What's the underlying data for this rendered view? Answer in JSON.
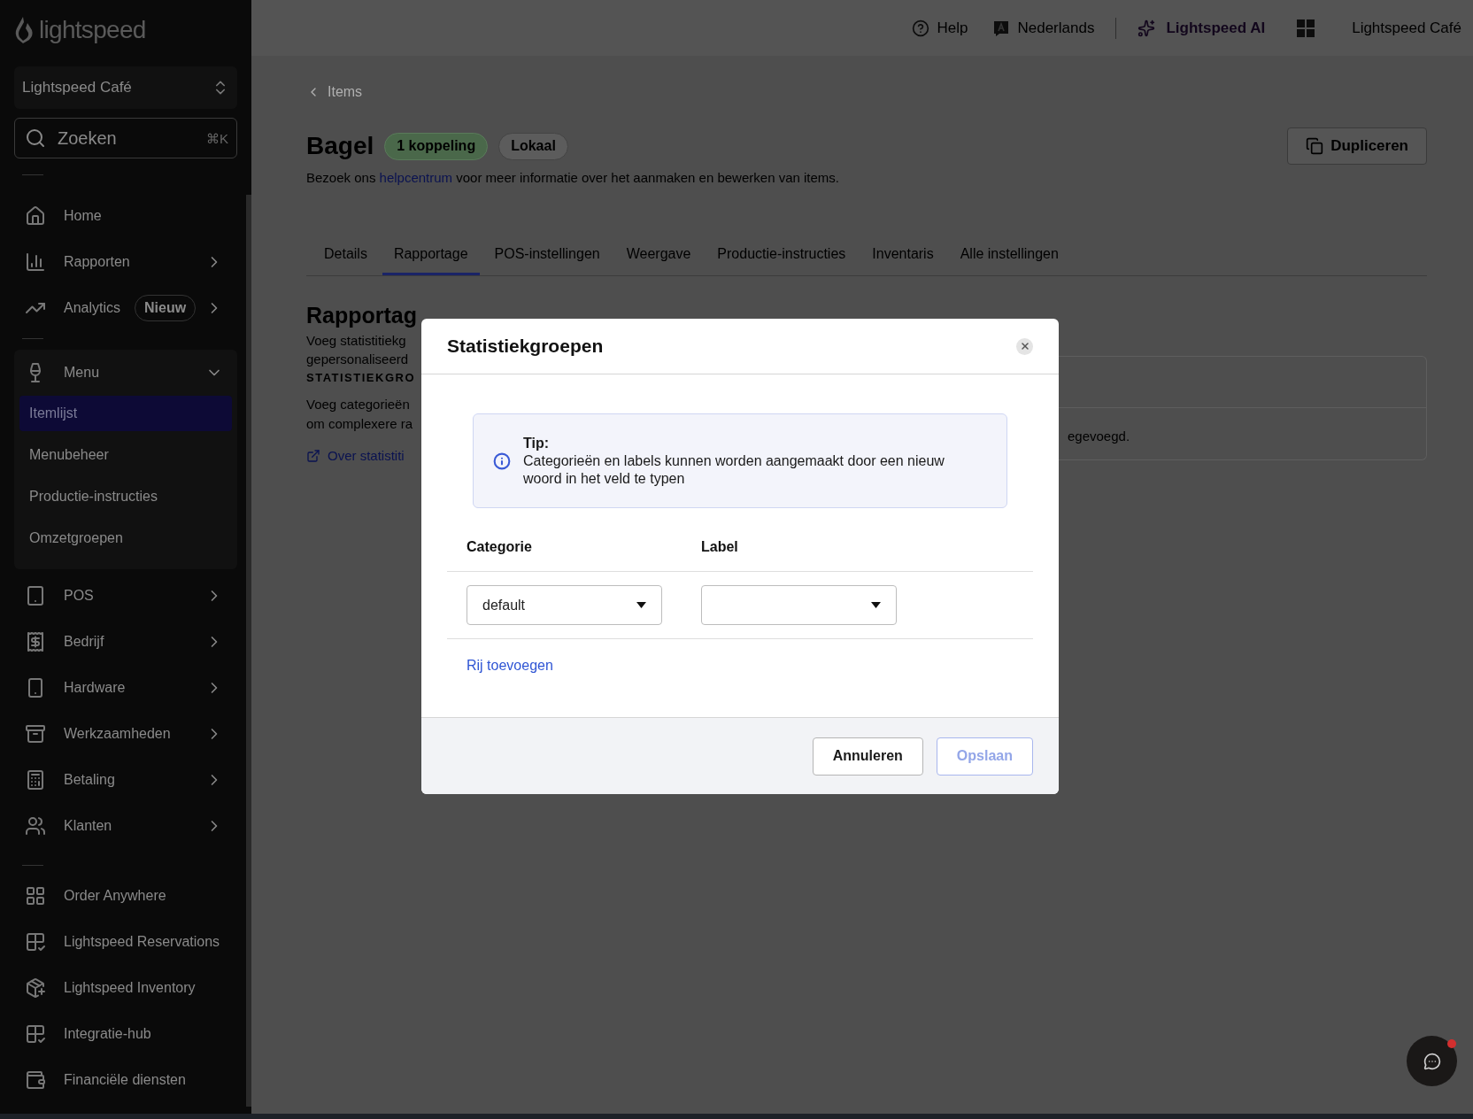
{
  "sidebar": {
    "logo": "lightspeed",
    "store": "Lightspeed Café",
    "search": {
      "placeholder": "Zoeken",
      "shortcut": "⌘K"
    },
    "groups": [
      [
        {
          "label": "Home",
          "has_submenu": false
        },
        {
          "label": "Rapporten",
          "has_submenu": true
        },
        {
          "label": "Analytics",
          "has_submenu": true,
          "badge": "Nieuw"
        }
      ],
      [
        {
          "label": "Menu",
          "has_submenu": true,
          "expanded": true,
          "children": [
            {
              "label": "Itemlijst",
              "selected": true
            },
            {
              "label": "Menubeheer",
              "selected": false
            },
            {
              "label": "Productie-instructies",
              "selected": false
            },
            {
              "label": "Omzetgroepen",
              "selected": false
            }
          ]
        },
        {
          "label": "POS",
          "has_submenu": true
        },
        {
          "label": "Bedrijf",
          "has_submenu": true
        },
        {
          "label": "Hardware",
          "has_submenu": true
        },
        {
          "label": "Werkzaamheden",
          "has_submenu": true
        },
        {
          "label": "Betaling",
          "has_submenu": true
        },
        {
          "label": "Klanten",
          "has_submenu": true
        }
      ],
      [
        {
          "label": "Order Anywhere",
          "has_submenu": false
        },
        {
          "label": "Lightspeed Reservations",
          "has_submenu": false
        },
        {
          "label": "Lightspeed Inventory",
          "has_submenu": false
        },
        {
          "label": "Integratie-hub",
          "has_submenu": false
        },
        {
          "label": "Financiële diensten",
          "has_submenu": false
        }
      ]
    ]
  },
  "top_bar": {
    "help": "Help",
    "language": "Nederlands",
    "ai": "Lightspeed AI",
    "account": "Lightspeed Café"
  },
  "page": {
    "breadcrumb": "Items",
    "title": "Bagel",
    "badges": [
      {
        "label": "1 koppeling",
        "kind": "success"
      },
      {
        "label": "Lokaal",
        "kind": "neutral"
      }
    ],
    "duplicate_button": "Dupliceren",
    "help_text": {
      "before": "Bezoek ons ",
      "link": "helpcentrum",
      "after": " voor meer informatie over het aanmaken en bewerken van items."
    },
    "tabs": [
      {
        "label": "Details",
        "selected": false
      },
      {
        "label": "Rapportage",
        "selected": true
      },
      {
        "label": "POS-instellingen",
        "selected": false
      },
      {
        "label": "Weergave",
        "selected": false
      },
      {
        "label": "Productie-instructies",
        "selected": false
      },
      {
        "label": "Inventaris",
        "selected": false
      },
      {
        "label": "Alle instellingen",
        "selected": false
      }
    ],
    "section": {
      "heading": "Rapportag",
      "intro": [
        "Voeg statistitiekg",
        "gepersonaliseerd"
      ],
      "label": "STATISTIEKGRO",
      "text": [
        "Voeg categorieën",
        "om complexere ra"
      ],
      "link": "Over statistiti",
      "card_text": "egevoegd."
    }
  },
  "modal": {
    "title": "Statistiekgroepen",
    "tip": {
      "title": "Tip:",
      "text": "Categorieën en labels kunnen worden aangemaakt door een nieuw woord in het veld te typen"
    },
    "columns": [
      "Categorie",
      "Label"
    ],
    "rows": [
      {
        "category": "default"
      }
    ],
    "add_row": "Rij toevoegen",
    "buttons": [
      {
        "label": "Annuleren",
        "kind": "secondary",
        "disabled": false
      },
      {
        "label": "Opslaan",
        "kind": "primary",
        "disabled": true
      }
    ]
  },
  "chat_button": {
    "unread": true
  }
}
